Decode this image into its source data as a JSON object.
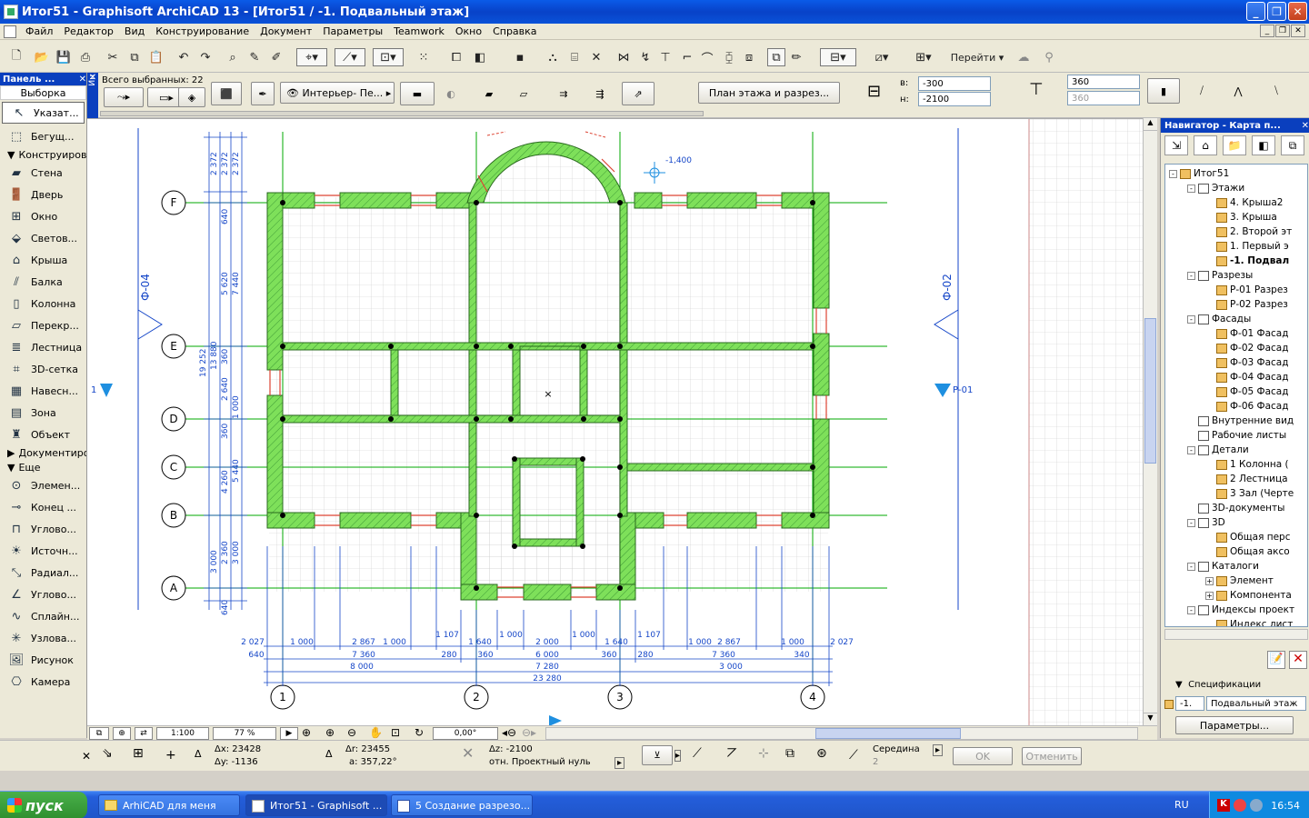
{
  "window": {
    "title": "Итог51 - Graphisoft ArchiCAD 13 - [Итог51 / -1. Подвальный этаж]"
  },
  "menu": [
    "Файл",
    "Редактор",
    "Вид",
    "Конструирование",
    "Документ",
    "Параметры",
    "Teamwork",
    "Окно",
    "Справка"
  ],
  "toolbar": {
    "goto_label": "Перейти"
  },
  "infobox": {
    "title": "Ин",
    "selected_count": "Всего выбранных: 22",
    "layer_label": "Интерьер- Пе...",
    "view_button": "План этажа и разрез...",
    "top_label": "в:",
    "top_value": "-300",
    "bottom_label": "н:",
    "bottom_value": "-2100",
    "thickness": "360",
    "thickness2": "360"
  },
  "left_panel": {
    "title": "Панель ...",
    "selection_section": "Выборка",
    "tools_top": [
      {
        "label": "Указат...",
        "icon": "arrow-pointer-icon"
      },
      {
        "label": "Бегущ...",
        "icon": "marquee-icon"
      }
    ],
    "section_design": "Конструирование",
    "design_tools": [
      {
        "label": "Стена",
        "icon": "wall-icon"
      },
      {
        "label": "Дверь",
        "icon": "door-icon"
      },
      {
        "label": "Окно",
        "icon": "window-icon"
      },
      {
        "label": "Светов...",
        "icon": "skylight-icon"
      },
      {
        "label": "Крыша",
        "icon": "roof-icon"
      },
      {
        "label": "Балка",
        "icon": "beam-icon"
      },
      {
        "label": "Колонна",
        "icon": "column-icon"
      },
      {
        "label": "Перекр...",
        "icon": "slab-icon"
      },
      {
        "label": "Лестница",
        "icon": "stair-icon"
      },
      {
        "label": "3D-сетка",
        "icon": "mesh-icon"
      },
      {
        "label": "Навесн...",
        "icon": "curtain-wall-icon"
      },
      {
        "label": "Зона",
        "icon": "zone-icon"
      },
      {
        "label": "Объект",
        "icon": "object-icon"
      }
    ],
    "section_document": "Документирование",
    "section_more": "Еще",
    "more_tools": [
      {
        "label": "Элемен...",
        "icon": "element-marker-icon"
      },
      {
        "label": "Конец ...",
        "icon": "end-marker-icon"
      },
      {
        "label": "Углово...",
        "icon": "corner-icon"
      },
      {
        "label": "Источн...",
        "icon": "light-icon"
      },
      {
        "label": "Радиал...",
        "icon": "radial-dimension-icon"
      },
      {
        "label": "Углово...",
        "icon": "angle-dimension-icon"
      },
      {
        "label": "Сплайн...",
        "icon": "spline-icon"
      },
      {
        "label": "Узлова...",
        "icon": "hotspot-icon"
      },
      {
        "label": "Рисунок",
        "icon": "picture-icon"
      },
      {
        "label": "Камера",
        "icon": "camera-icon"
      }
    ]
  },
  "plan": {
    "axes_rows": [
      "F",
      "E",
      "D",
      "C",
      "B",
      "A"
    ],
    "axes_cols": [
      "1",
      "2",
      "3",
      "4"
    ],
    "facade_left": "Ф-04",
    "facade_right": "Ф-02",
    "section_marker": "Р-01",
    "elevation_label": "-1,400",
    "left_dims": [
      "2 372",
      "2 372",
      "2 372",
      "640",
      "5 620",
      "7 440",
      "13 880",
      "19 252",
      "360",
      "2 640",
      "1 000",
      "360",
      "4 260",
      "5 440",
      "3 000",
      "2 360",
      "3 000",
      "640"
    ],
    "bottom_dims_row1": [
      "2 027",
      "1 000",
      "2 867",
      "1 000",
      "1 107",
      "1 640",
      "1 000",
      "2 000",
      "1 000",
      "1 640",
      "1 107",
      "1 000",
      "2 867",
      "1 000",
      "2 027"
    ],
    "bottom_dims_row2": [
      "640",
      "7 360",
      "280",
      "360",
      "6 000",
      "360",
      "280",
      "7 360",
      "340"
    ],
    "bottom_dims_row3": [
      "8 000",
      "7 280",
      "3 000"
    ],
    "bottom_total": "23 280"
  },
  "zoom_bar": {
    "scale": "1:100",
    "zoom": "77 %",
    "angle": "0,00°"
  },
  "navigator": {
    "title": "Навигатор - Карта п...",
    "tree": [
      {
        "label": "Итог51",
        "level": 0,
        "exp": "-"
      },
      {
        "label": "Этажи",
        "level": 1,
        "exp": "-"
      },
      {
        "label": "4. Крыша2",
        "level": 2
      },
      {
        "label": "3. Крыша",
        "level": 2
      },
      {
        "label": "2. Второй эт",
        "level": 2
      },
      {
        "label": "1. Первый э",
        "level": 2
      },
      {
        "label": "-1. Подвал",
        "level": 2,
        "bold": true
      },
      {
        "label": "Разрезы",
        "level": 1,
        "exp": "-"
      },
      {
        "label": "Р-01 Разрез",
        "level": 2
      },
      {
        "label": "Р-02 Разрез",
        "level": 2
      },
      {
        "label": "Фасады",
        "level": 1,
        "exp": "-"
      },
      {
        "label": "Ф-01 Фасад",
        "level": 2
      },
      {
        "label": "Ф-02 Фасад",
        "level": 2
      },
      {
        "label": "Ф-03 Фасад",
        "level": 2
      },
      {
        "label": "Ф-04 Фасад",
        "level": 2
      },
      {
        "label": "Ф-05 Фасад",
        "level": 2
      },
      {
        "label": "Ф-06 Фасад",
        "level": 2
      },
      {
        "label": "Внутренние вид",
        "level": 1
      },
      {
        "label": "Рабочие листы",
        "level": 1
      },
      {
        "label": "Детали",
        "level": 1,
        "exp": "-"
      },
      {
        "label": "1 Колонна (",
        "level": 2
      },
      {
        "label": "2 Лестница",
        "level": 2
      },
      {
        "label": "3 Зал (Черте",
        "level": 2
      },
      {
        "label": "3D-документы",
        "level": 1
      },
      {
        "label": "3D",
        "level": 1,
        "exp": "-"
      },
      {
        "label": "Общая перс",
        "level": 2
      },
      {
        "label": "Общая аксо",
        "level": 2
      },
      {
        "label": "Каталоги",
        "level": 1,
        "exp": "-"
      },
      {
        "label": "Элемент",
        "level": 2,
        "exp": "+"
      },
      {
        "label": "Компонента",
        "level": 2,
        "exp": "+"
      },
      {
        "label": "Индексы проект",
        "level": 1,
        "exp": "-"
      },
      {
        "label": "Индекс лист",
        "level": 2
      }
    ],
    "spec_label": "Спецификации",
    "spec_id": "-1.",
    "spec_name": "Подвальный этаж",
    "params_button": "Параметры..."
  },
  "status": {
    "dx": "Δx: 23428",
    "dy": "Δy: -1136",
    "r": "Δr: 23455",
    "a": "a: 357,22°",
    "dz": "Δz: -2100",
    "ref": "отн. Проектный нуль",
    "snap": "Середина",
    "snap_n": "2",
    "ok": "OK",
    "cancel": "Отменить"
  },
  "taskbar": {
    "start": "пуск",
    "tasks": [
      "ArhiCAD для меня",
      "Итог51 - Graphisoft ...",
      "5 Создание разрезо..."
    ],
    "lang": "RU",
    "time": "16:54"
  }
}
